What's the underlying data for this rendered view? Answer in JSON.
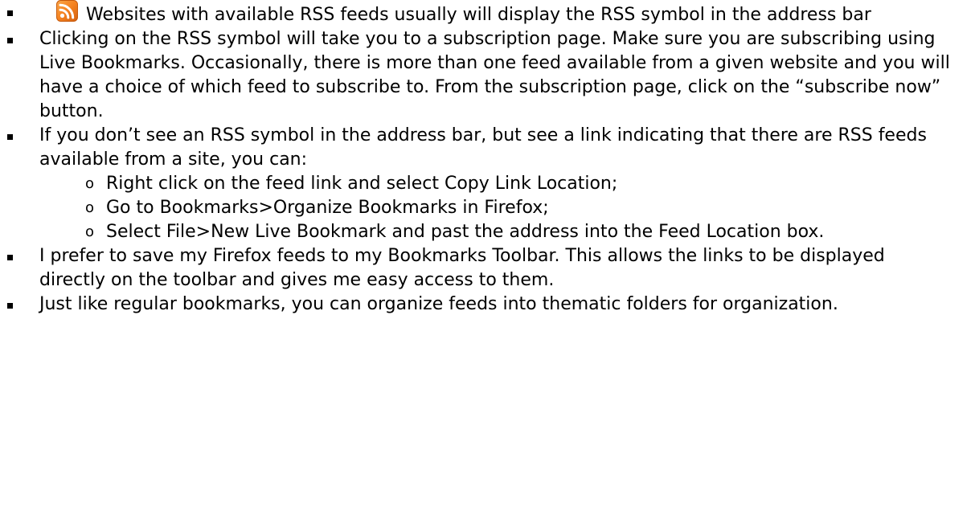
{
  "icons": {
    "rss": "rss-feed-icon",
    "rss_color": "#f58220"
  },
  "bullets": [
    {
      "text": "Websites with available RSS feeds usually will display the RSS symbol in the address bar"
    },
    {
      "text": "Clicking on the RSS symbol will take you to a subscription page.  Make sure you are subscribing using Live Bookmarks.  Occasionally, there is more than one feed available from a given website and you will have a choice of which feed to subscribe to.  From the subscription page, click on the “subscribe now” button."
    },
    {
      "text": "If you don’t see an RSS symbol in the address bar, but see a link indicating that there are RSS feeds available from a site, you can:",
      "sub": [
        "Right click on the feed link and select Copy Link Location;",
        "Go to Bookmarks>Organize Bookmarks in Firefox;",
        "Select File>New Live Bookmark and past the address into the Feed Location box."
      ]
    },
    {
      "text": "I prefer to save my Firefox feeds to my Bookmarks Toolbar.  This allows the links to be displayed directly on the toolbar and gives me easy access to them."
    },
    {
      "text": "Just like regular bookmarks, you can organize feeds into thematic folders for organization."
    }
  ]
}
